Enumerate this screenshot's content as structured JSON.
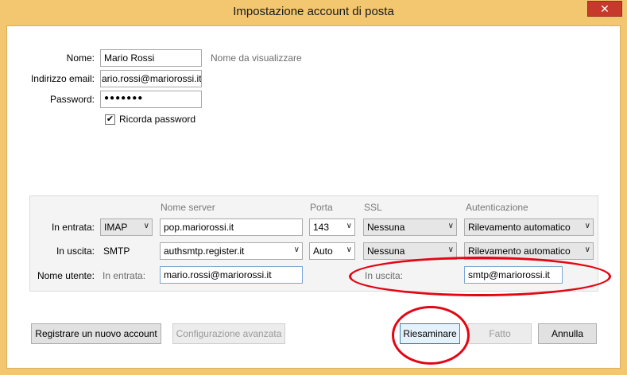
{
  "window": {
    "title": "Impostazione account di posta",
    "close_glyph": "✕"
  },
  "identity": {
    "name_label": "Nome:",
    "name_value": "Mario Rossi",
    "name_hint": "Nome da visualizzare",
    "email_label": "Indirizzo email:",
    "email_value": "ario.rossi@mariorossi.it",
    "password_label": "Password:",
    "password_value": "●●●●●●●",
    "remember_label": "Ricorda password",
    "remember_checked": true,
    "check_glyph": "✔"
  },
  "servers": {
    "headers": {
      "server": "Nome server",
      "port": "Porta",
      "ssl": "SSL",
      "auth": "Autenticazione"
    },
    "incoming": {
      "label": "In entrata:",
      "protocol": "IMAP",
      "server": "pop.mariorossi.it",
      "port": "143",
      "ssl": "Nessuna",
      "auth": "Rilevamento automatico"
    },
    "outgoing": {
      "label": "In uscita:",
      "protocol": "SMTP",
      "server": "authsmtp.register.it",
      "port": "Auto",
      "ssl": "Nessuna",
      "auth": "Rilevamento automatico"
    },
    "username": {
      "label": "Nome utente:",
      "incoming_label": "In entrata:",
      "incoming_value": "mario.rossi@mariorossi.it",
      "outgoing_label": "In uscita:",
      "outgoing_value": "smtp@mariorossi.it"
    },
    "dropdown_glyph": "∨"
  },
  "buttons": {
    "register": "Registrare un nuovo account",
    "advanced": "Configurazione avanzata",
    "retest": "Riesaminare",
    "done": "Fatto",
    "cancel": "Annulla"
  },
  "colors": {
    "title_bar": "#f2c770",
    "annotation_red": "#e30613",
    "close_button": "#c7392b"
  }
}
